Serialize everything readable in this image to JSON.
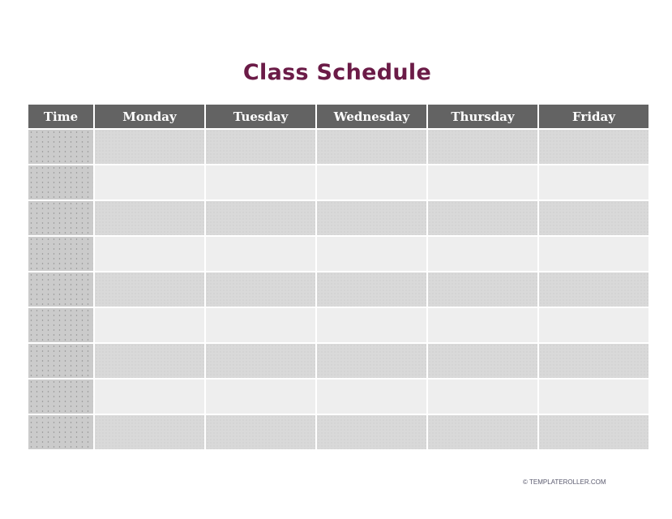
{
  "title": "Class Schedule",
  "table": {
    "headers": [
      "Time",
      "Monday",
      "Tuesday",
      "Wednesday",
      "Thursday",
      "Friday"
    ],
    "rows": [
      [
        "",
        "",
        "",
        "",
        "",
        ""
      ],
      [
        "",
        "",
        "",
        "",
        "",
        ""
      ],
      [
        "",
        "",
        "",
        "",
        "",
        ""
      ],
      [
        "",
        "",
        "",
        "",
        "",
        ""
      ],
      [
        "",
        "",
        "",
        "",
        "",
        ""
      ],
      [
        "",
        "",
        "",
        "",
        "",
        ""
      ],
      [
        "",
        "",
        "",
        "",
        "",
        ""
      ],
      [
        "",
        "",
        "",
        "",
        "",
        ""
      ],
      [
        "",
        "",
        "",
        "",
        "",
        ""
      ]
    ]
  },
  "footer": "© TEMPLATEROLLER.COM",
  "colors": {
    "title": "#6b1b47",
    "header_bg": "#636363",
    "header_text": "#ffffff",
    "row_shaded": "#d9d9d9",
    "row_light": "#eeeeee",
    "time_cell": "#cbcbcb"
  }
}
